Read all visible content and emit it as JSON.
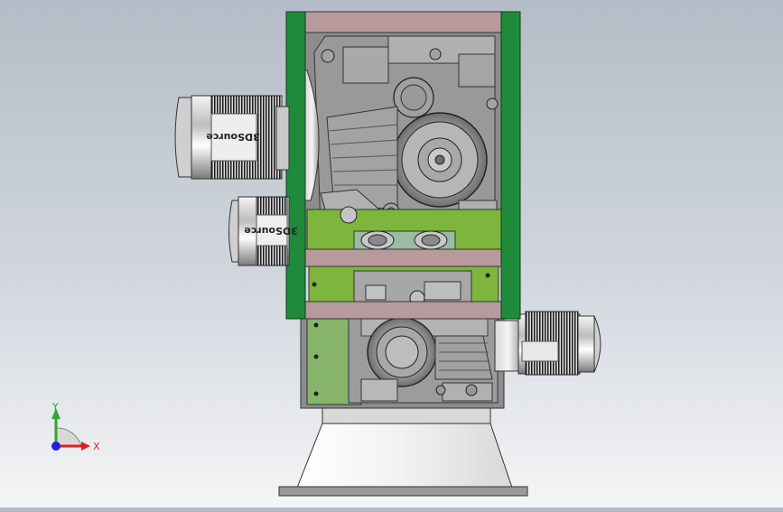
{
  "viewport": {
    "motor_brand_upper": "3DSource",
    "motor_brand_lower": "3DSource"
  },
  "triad": {
    "y_label": "Y",
    "x_label": "X",
    "y_color": "#2ea82e",
    "x_color": "#e02020",
    "z_color": "#2020e0"
  },
  "colors": {
    "frame_green": "#1f8a3a",
    "beam_rose": "#b89a9c",
    "plate_green": "#7db33a",
    "housing_gray": "#8c8c8c",
    "base_gray": "#9a9a9a"
  }
}
